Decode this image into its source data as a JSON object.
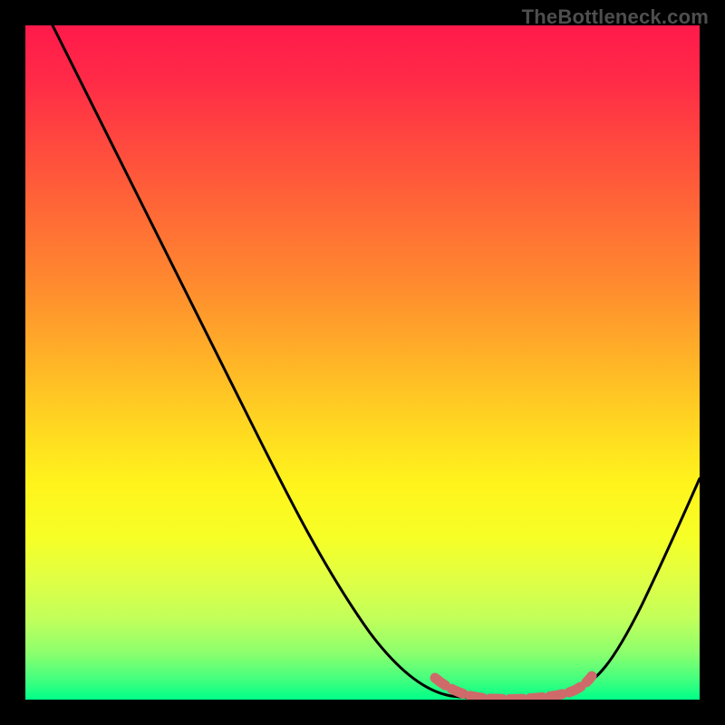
{
  "watermark": "TheBottleneck.com",
  "chart_data": {
    "type": "line",
    "title": "",
    "xlabel": "",
    "ylabel": "",
    "xlim": [
      0,
      100
    ],
    "ylim": [
      0,
      100
    ],
    "grid": false,
    "series": [
      {
        "name": "curve",
        "color": "#000000",
        "x": [
          4,
          10,
          16,
          22,
          28,
          34,
          40,
          46,
          52,
          58,
          62,
          66,
          69,
          72,
          75,
          78,
          81,
          84,
          88,
          92,
          96,
          100
        ],
        "y": [
          100,
          91,
          82,
          73,
          64,
          55,
          46,
          37,
          28,
          19,
          12,
          6,
          2.5,
          1,
          0.5,
          0.5,
          1,
          3,
          8,
          15,
          23,
          31
        ]
      },
      {
        "name": "highlight",
        "color": "#cf6a6a",
        "x": [
          62,
          66,
          69,
          72,
          75,
          78,
          81,
          84
        ],
        "y": [
          2.8,
          1.6,
          1.0,
          0.7,
          0.6,
          0.7,
          1.0,
          2.2
        ]
      }
    ],
    "gradient_stops": [
      {
        "pos": 0,
        "color": "#ff1a4b"
      },
      {
        "pos": 50,
        "color": "#ffd222"
      },
      {
        "pos": 100,
        "color": "#00ff88"
      }
    ]
  }
}
